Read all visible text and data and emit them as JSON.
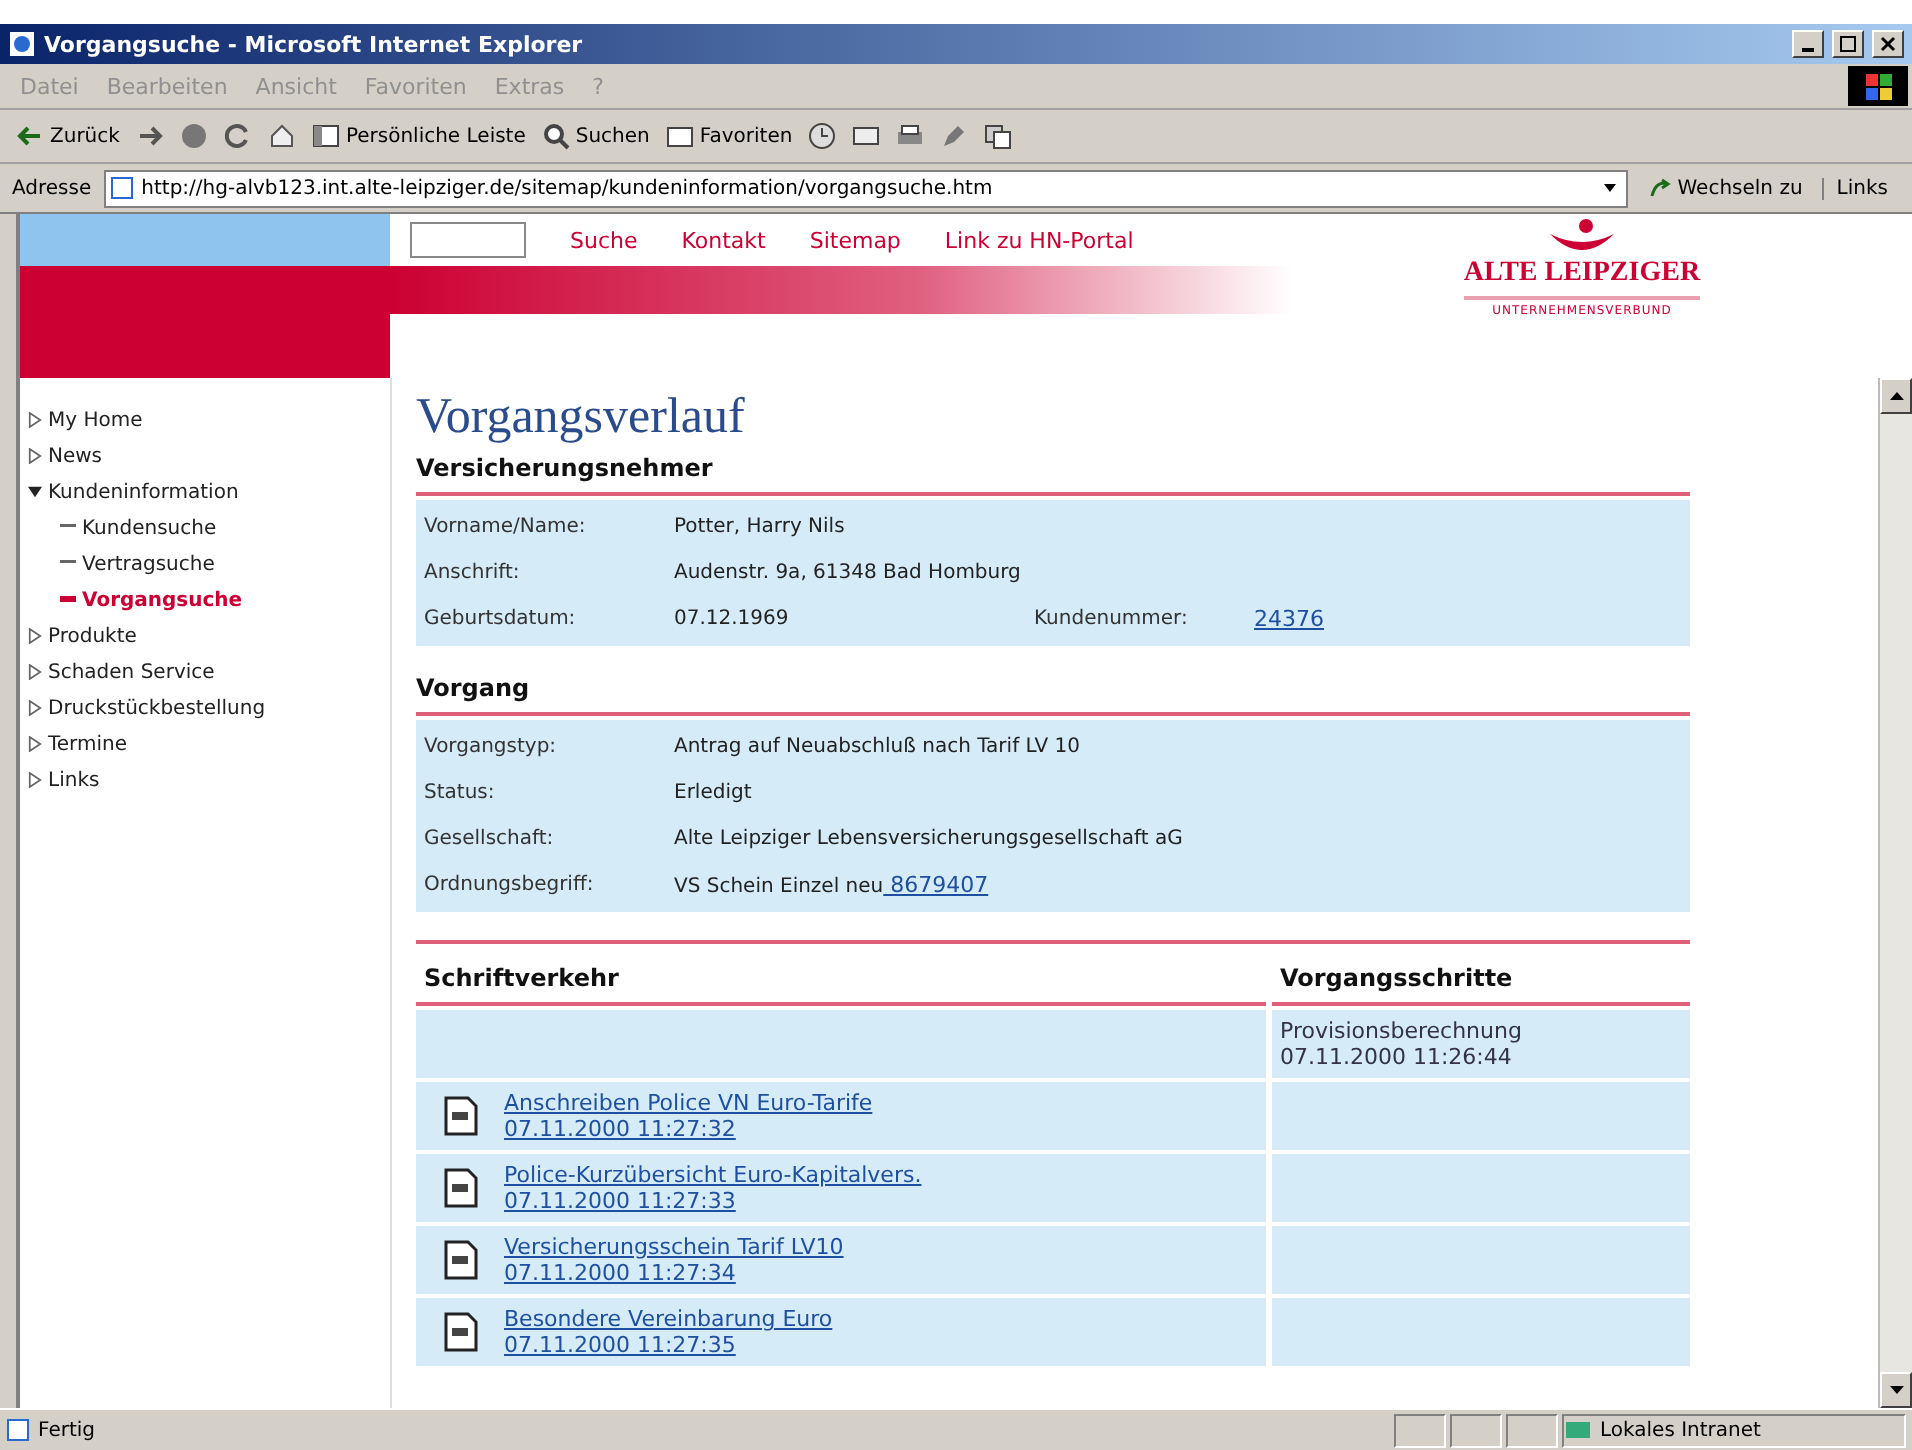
{
  "window": {
    "title": "Vorgangsuche - Microsoft Internet Explorer"
  },
  "menu": [
    "Datei",
    "Bearbeiten",
    "Ansicht",
    "Favoriten",
    "Extras",
    "?"
  ],
  "toolbar": [
    {
      "kind": "back",
      "label": "Zurück"
    },
    {
      "kind": "forward"
    },
    {
      "kind": "stop"
    },
    {
      "kind": "refresh"
    },
    {
      "kind": "home"
    },
    {
      "kind": "panel",
      "label": "Persönliche Leiste"
    },
    {
      "kind": "search",
      "label": "Suchen"
    },
    {
      "kind": "favorites",
      "label": "Favoriten"
    },
    {
      "kind": "history"
    },
    {
      "kind": "mail"
    },
    {
      "kind": "print"
    },
    {
      "kind": "edit"
    },
    {
      "kind": "discuss"
    }
  ],
  "address": {
    "label": "Adresse",
    "url": "http://hg-alvb123.int.alte-leipziger.de/sitemap/kundeninformation/vorgangsuche.htm",
    "go": "Wechseln zu",
    "links": "Links"
  },
  "header": {
    "links": [
      "Suche",
      "Kontakt",
      "Sitemap",
      "Link zu HN-Portal"
    ],
    "logo": "ALTE LEIPZIGER",
    "logo_sub": "UNTERNEHMENSVERBUND"
  },
  "nav": [
    {
      "label": "My Home",
      "expanded": false
    },
    {
      "label": "News",
      "expanded": false
    },
    {
      "label": "Kundeninformation",
      "expanded": true,
      "children": [
        {
          "label": "Kundensuche",
          "selected": false
        },
        {
          "label": "Vertragsuche",
          "selected": false
        },
        {
          "label": "Vorgangsuche",
          "selected": true
        }
      ]
    },
    {
      "label": "Produkte",
      "expanded": false
    },
    {
      "label": "Schaden Service",
      "expanded": false
    },
    {
      "label": "Druckstückbestellung",
      "expanded": false
    },
    {
      "label": "Termine",
      "expanded": false
    },
    {
      "label": "Links",
      "expanded": false
    }
  ],
  "page_title": "Vorgangsverlauf",
  "versicherungsnehmer": {
    "heading": "Versicherungsnehmer",
    "rows": [
      {
        "label": "Vorname/Name:",
        "value": "Potter, Harry Nils"
      },
      {
        "label": "Anschrift:",
        "value": "Audenstr. 9a, 61348 Bad Homburg"
      },
      {
        "label": "Geburtsdatum:",
        "value": "07.12.1969",
        "label_2": "Kundenummer:",
        "link": "24376"
      }
    ]
  },
  "vorgang": {
    "heading": "Vorgang",
    "rows": [
      {
        "label": "Vorgangstyp:",
        "value": "Antrag auf Neuabschluß nach Tarif LV 10"
      },
      {
        "label": "Status:",
        "value": "Erledigt"
      },
      {
        "label": "Gesellschaft:",
        "value": "Alte Leipziger Lebensversicherungsgesellschaft aG"
      },
      {
        "label": "Ordnungsbegriff:",
        "value": "VS Schein Einzel neu",
        "link": "8679407"
      }
    ]
  },
  "history": {
    "columns": [
      "Schriftverkehr",
      "Vorgangsschritte"
    ],
    "step": {
      "name": "Provisionsberechnung",
      "time": "07.11.2000 11:26:44"
    },
    "documents": [
      {
        "title": "Anschreiben Police VN Euro-Tarife",
        "time": "07.11.2000 11:27:32"
      },
      {
        "title": "Police-Kurzübersicht Euro-Kapitalvers.",
        "time": "07.11.2000 11:27:33"
      },
      {
        "title": "Versicherungsschein Tarif LV10",
        "time": "07.11.2000 11:27:34"
      },
      {
        "title": "Besondere Vereinbarung Euro",
        "time": "07.11.2000 11:27:35"
      }
    ]
  },
  "status_bar": {
    "text": "Fertig",
    "zone": "Lokales Intranet"
  }
}
